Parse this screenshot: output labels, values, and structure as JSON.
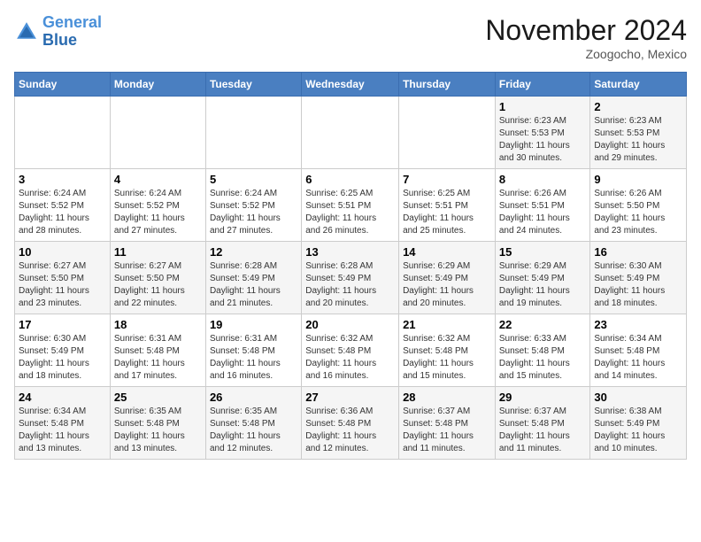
{
  "logo": {
    "line1": "General",
    "line2": "Blue"
  },
  "title": "November 2024",
  "subtitle": "Zoogocho, Mexico",
  "weekdays": [
    "Sunday",
    "Monday",
    "Tuesday",
    "Wednesday",
    "Thursday",
    "Friday",
    "Saturday"
  ],
  "weeks": [
    [
      {
        "day": "",
        "info": ""
      },
      {
        "day": "",
        "info": ""
      },
      {
        "day": "",
        "info": ""
      },
      {
        "day": "",
        "info": ""
      },
      {
        "day": "",
        "info": ""
      },
      {
        "day": "1",
        "info": "Sunrise: 6:23 AM\nSunset: 5:53 PM\nDaylight: 11 hours\nand 30 minutes."
      },
      {
        "day": "2",
        "info": "Sunrise: 6:23 AM\nSunset: 5:53 PM\nDaylight: 11 hours\nand 29 minutes."
      }
    ],
    [
      {
        "day": "3",
        "info": "Sunrise: 6:24 AM\nSunset: 5:52 PM\nDaylight: 11 hours\nand 28 minutes."
      },
      {
        "day": "4",
        "info": "Sunrise: 6:24 AM\nSunset: 5:52 PM\nDaylight: 11 hours\nand 27 minutes."
      },
      {
        "day": "5",
        "info": "Sunrise: 6:24 AM\nSunset: 5:52 PM\nDaylight: 11 hours\nand 27 minutes."
      },
      {
        "day": "6",
        "info": "Sunrise: 6:25 AM\nSunset: 5:51 PM\nDaylight: 11 hours\nand 26 minutes."
      },
      {
        "day": "7",
        "info": "Sunrise: 6:25 AM\nSunset: 5:51 PM\nDaylight: 11 hours\nand 25 minutes."
      },
      {
        "day": "8",
        "info": "Sunrise: 6:26 AM\nSunset: 5:51 PM\nDaylight: 11 hours\nand 24 minutes."
      },
      {
        "day": "9",
        "info": "Sunrise: 6:26 AM\nSunset: 5:50 PM\nDaylight: 11 hours\nand 23 minutes."
      }
    ],
    [
      {
        "day": "10",
        "info": "Sunrise: 6:27 AM\nSunset: 5:50 PM\nDaylight: 11 hours\nand 23 minutes."
      },
      {
        "day": "11",
        "info": "Sunrise: 6:27 AM\nSunset: 5:50 PM\nDaylight: 11 hours\nand 22 minutes."
      },
      {
        "day": "12",
        "info": "Sunrise: 6:28 AM\nSunset: 5:49 PM\nDaylight: 11 hours\nand 21 minutes."
      },
      {
        "day": "13",
        "info": "Sunrise: 6:28 AM\nSunset: 5:49 PM\nDaylight: 11 hours\nand 20 minutes."
      },
      {
        "day": "14",
        "info": "Sunrise: 6:29 AM\nSunset: 5:49 PM\nDaylight: 11 hours\nand 20 minutes."
      },
      {
        "day": "15",
        "info": "Sunrise: 6:29 AM\nSunset: 5:49 PM\nDaylight: 11 hours\nand 19 minutes."
      },
      {
        "day": "16",
        "info": "Sunrise: 6:30 AM\nSunset: 5:49 PM\nDaylight: 11 hours\nand 18 minutes."
      }
    ],
    [
      {
        "day": "17",
        "info": "Sunrise: 6:30 AM\nSunset: 5:49 PM\nDaylight: 11 hours\nand 18 minutes."
      },
      {
        "day": "18",
        "info": "Sunrise: 6:31 AM\nSunset: 5:48 PM\nDaylight: 11 hours\nand 17 minutes."
      },
      {
        "day": "19",
        "info": "Sunrise: 6:31 AM\nSunset: 5:48 PM\nDaylight: 11 hours\nand 16 minutes."
      },
      {
        "day": "20",
        "info": "Sunrise: 6:32 AM\nSunset: 5:48 PM\nDaylight: 11 hours\nand 16 minutes."
      },
      {
        "day": "21",
        "info": "Sunrise: 6:32 AM\nSunset: 5:48 PM\nDaylight: 11 hours\nand 15 minutes."
      },
      {
        "day": "22",
        "info": "Sunrise: 6:33 AM\nSunset: 5:48 PM\nDaylight: 11 hours\nand 15 minutes."
      },
      {
        "day": "23",
        "info": "Sunrise: 6:34 AM\nSunset: 5:48 PM\nDaylight: 11 hours\nand 14 minutes."
      }
    ],
    [
      {
        "day": "24",
        "info": "Sunrise: 6:34 AM\nSunset: 5:48 PM\nDaylight: 11 hours\nand 13 minutes."
      },
      {
        "day": "25",
        "info": "Sunrise: 6:35 AM\nSunset: 5:48 PM\nDaylight: 11 hours\nand 13 minutes."
      },
      {
        "day": "26",
        "info": "Sunrise: 6:35 AM\nSunset: 5:48 PM\nDaylight: 11 hours\nand 12 minutes."
      },
      {
        "day": "27",
        "info": "Sunrise: 6:36 AM\nSunset: 5:48 PM\nDaylight: 11 hours\nand 12 minutes."
      },
      {
        "day": "28",
        "info": "Sunrise: 6:37 AM\nSunset: 5:48 PM\nDaylight: 11 hours\nand 11 minutes."
      },
      {
        "day": "29",
        "info": "Sunrise: 6:37 AM\nSunset: 5:48 PM\nDaylight: 11 hours\nand 11 minutes."
      },
      {
        "day": "30",
        "info": "Sunrise: 6:38 AM\nSunset: 5:49 PM\nDaylight: 11 hours\nand 10 minutes."
      }
    ]
  ]
}
